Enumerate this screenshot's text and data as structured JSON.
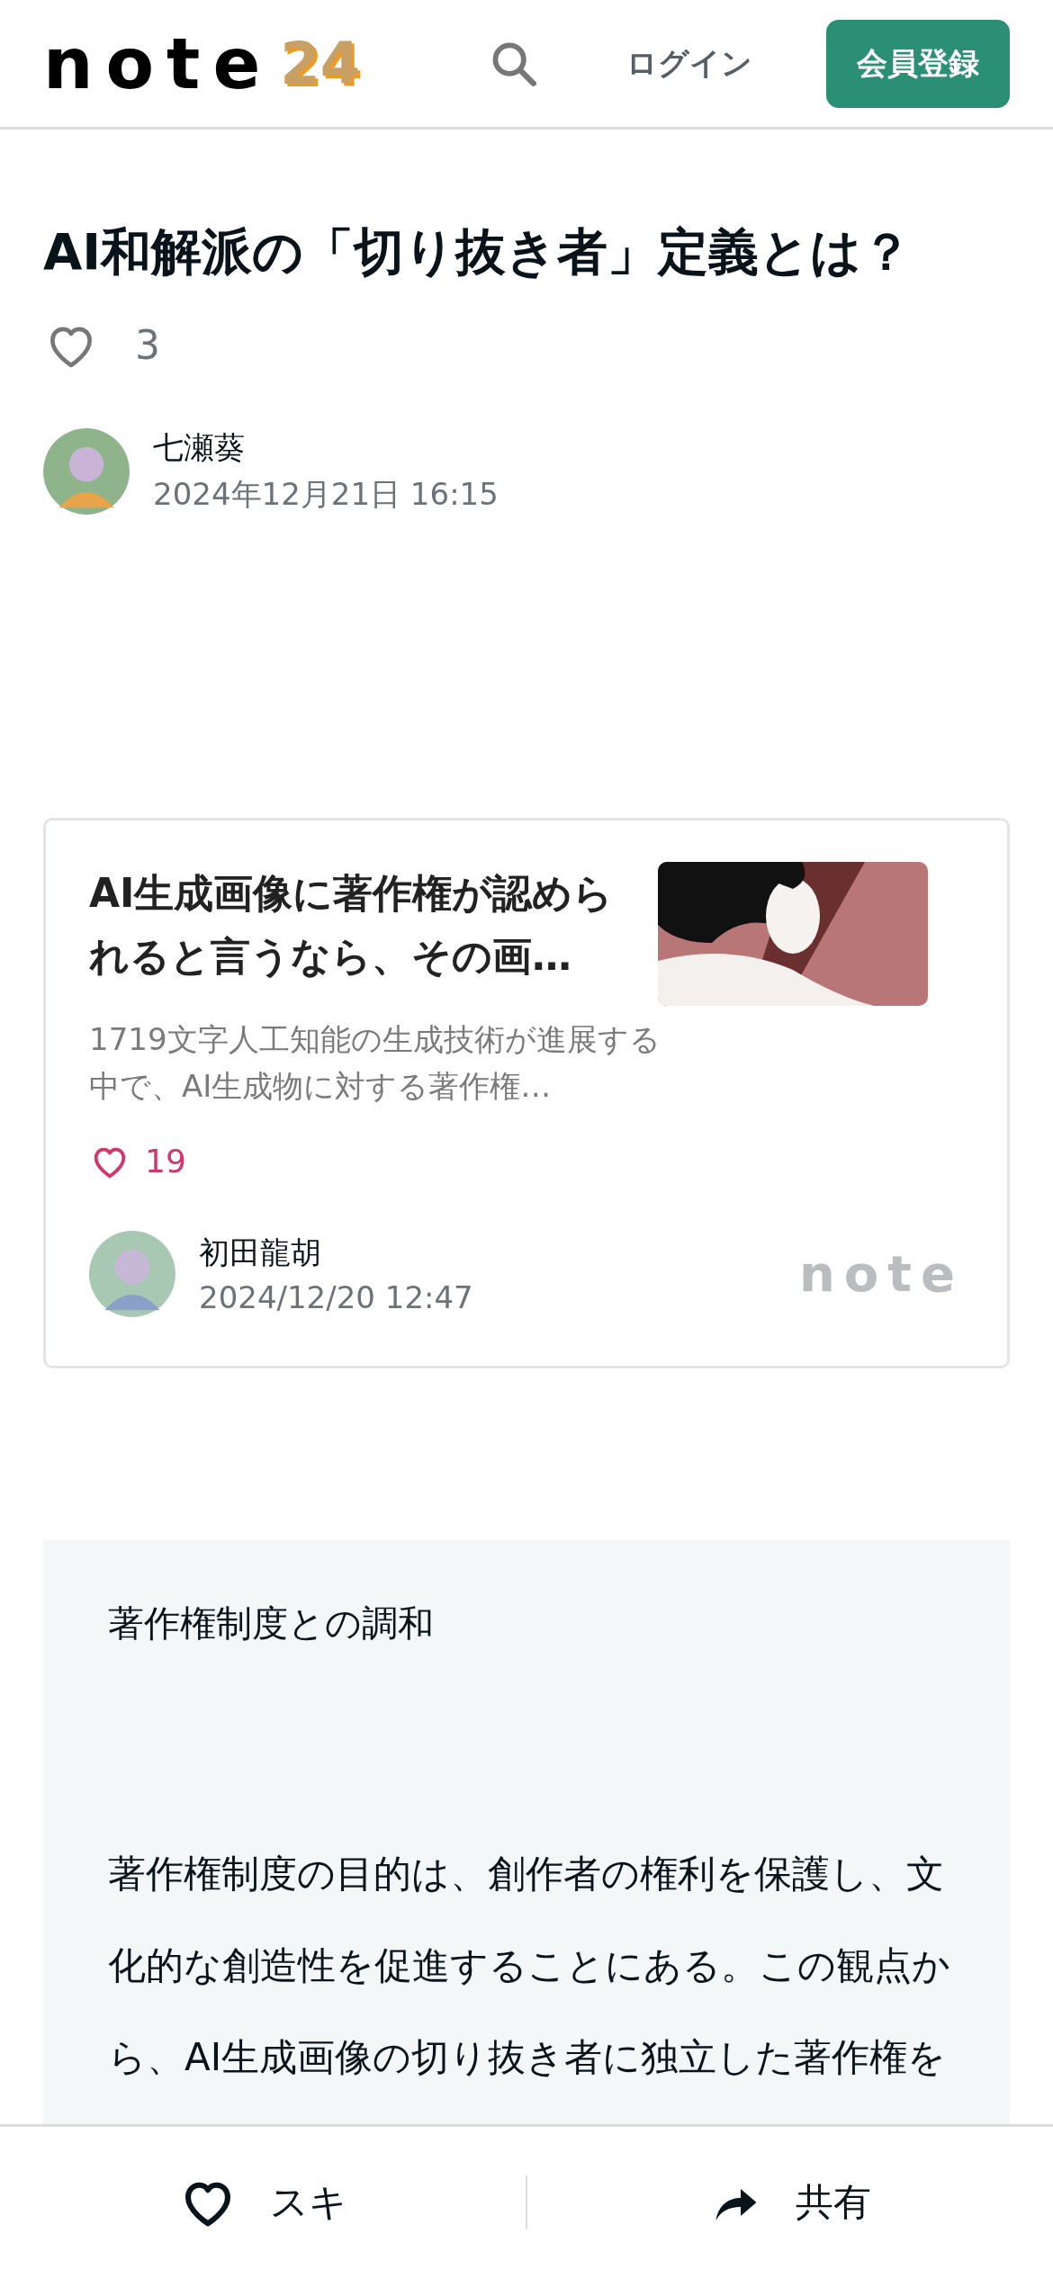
{
  "header": {
    "logo": "note",
    "logo_badge": "24",
    "login": "ログイン",
    "signup": "会員登録"
  },
  "article": {
    "title": "AI和解派の「切り抜き者」定義とは？",
    "likes": "3",
    "liked": false,
    "author": "七瀬葵",
    "date": "2024年12月21日 16:15"
  },
  "embed_card": {
    "title": "AI生成画像に著作権が認められると言うなら、その画…",
    "excerpt": "1719文字人工知能の生成技術が進展する中で、AI生成物に対する著作権…",
    "likes": "19",
    "author": "初田龍胡",
    "date": "2024/12/20 12:47",
    "brand": "note"
  },
  "quote": {
    "heading": "著作権制度との調和",
    "paragraph": "著作権制度の目的は、創作者の権利を保護し、文化的な創造性を促進することにある。この観点から、AI生成画像の切り抜き者に独立した著作権を"
  },
  "bottom_bar": [
    {
      "kind": "like",
      "label": "スキ"
    },
    {
      "kind": "share",
      "label": "共有"
    }
  ]
}
